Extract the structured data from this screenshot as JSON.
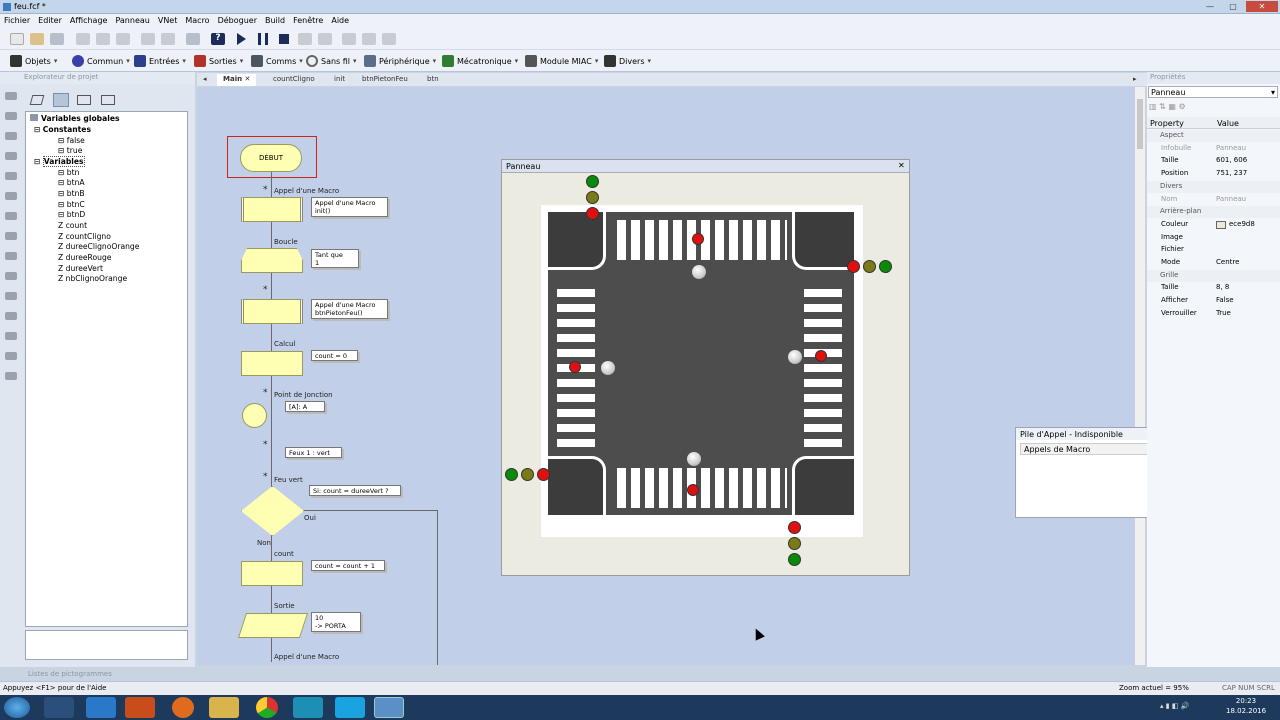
{
  "window": {
    "title": "feu.fcf *"
  },
  "menu": [
    "Fichier",
    "Editer",
    "Affichage",
    "Panneau",
    "VNet",
    "Macro",
    "Déboguer",
    "Build",
    "Fenêtre",
    "Aide"
  ],
  "toolbar2": {
    "objets": "Objets",
    "commun": "Commun",
    "entrees": "Entrées",
    "sorties": "Sorties",
    "comms": "Comms",
    "sansfil": "Sans fil",
    "peripherique": "Périphérique",
    "mecatronique": "Mécatronique",
    "miac": "Module MIAC",
    "divers": "Divers"
  },
  "explorer": {
    "title": "Explorateur de projet",
    "root": "Variables globales",
    "constantes": "Constantes",
    "const_items": [
      "false",
      "true"
    ],
    "variables": "Variables",
    "var_items": [
      "btn",
      "btnA",
      "btnB",
      "btnC",
      "btnD",
      "count",
      "countCligno",
      "dureeClignoOrange",
      "dureeRouge",
      "dureeVert",
      "nbClignoOrange"
    ],
    "footer": "Listes de pictogrammes"
  },
  "tabs": [
    "Main",
    "countCligno",
    "init",
    "btnPietonFeu",
    "btn"
  ],
  "flow": {
    "debut": "DÉBUT",
    "call1_label": "Appel d'une Macro",
    "call1_note": "Appel d'une Macro\ninit()",
    "boucle": "Boucle",
    "boucle_note": "Tant que\n1",
    "call2_note": "Appel d'une Macro\nbtnPietonFeu()",
    "calcul": "Calcul",
    "calcul_note": "count = 0",
    "jonction": "Point de Jonction",
    "jonction_note": "[A]: A",
    "feux_note": "Feux 1 : vert",
    "feuvert": "Feu vert",
    "decision_note": "Si: count = dureeVert ?",
    "oui": "Oui",
    "non": "Non",
    "count_lbl": "count",
    "count_note": "count = count + 1",
    "sortie": "Sortie",
    "sortie_note": "10\n-> PORTA",
    "call3": "Appel d'une Macro"
  },
  "panneau": {
    "title": "Panneau"
  },
  "pile": {
    "title": "Pile d'Appel - Indisponible",
    "header": "Appels de Macro"
  },
  "props": {
    "title": "Propriétés",
    "selector": "Panneau",
    "col_property": "Property",
    "col_value": "Value",
    "rows": [
      {
        "k": "Aspect",
        "v": "",
        "sec": true
      },
      {
        "k": "Infobulle",
        "v": "Panneau",
        "dim": true
      },
      {
        "k": "Taille",
        "v": "601, 606"
      },
      {
        "k": "Position",
        "v": "751, 237"
      },
      {
        "k": "Divers",
        "v": "",
        "sec": true
      },
      {
        "k": "Nom",
        "v": "Panneau",
        "dim": true
      },
      {
        "k": "Arrière-plan",
        "v": "",
        "sec": true
      },
      {
        "k": "Couleur",
        "v": "ece9d8"
      },
      {
        "k": "Image",
        "v": ""
      },
      {
        "k": "Fichier",
        "v": ""
      },
      {
        "k": "Mode",
        "v": "Centre"
      },
      {
        "k": "Grille",
        "v": "",
        "sec": true
      },
      {
        "k": "Taille",
        "v": "8, 8"
      },
      {
        "k": "Afficher",
        "v": "False"
      },
      {
        "k": "Verrouiller",
        "v": "True"
      }
    ]
  },
  "status": {
    "help": "Appuyez <F1> pour de l'Aide",
    "zoom": "Zoom actuel = 95%",
    "keys": "CAP NUM SCRL"
  },
  "taskbar": {
    "time": "20:23",
    "date": "18.02.2016"
  }
}
